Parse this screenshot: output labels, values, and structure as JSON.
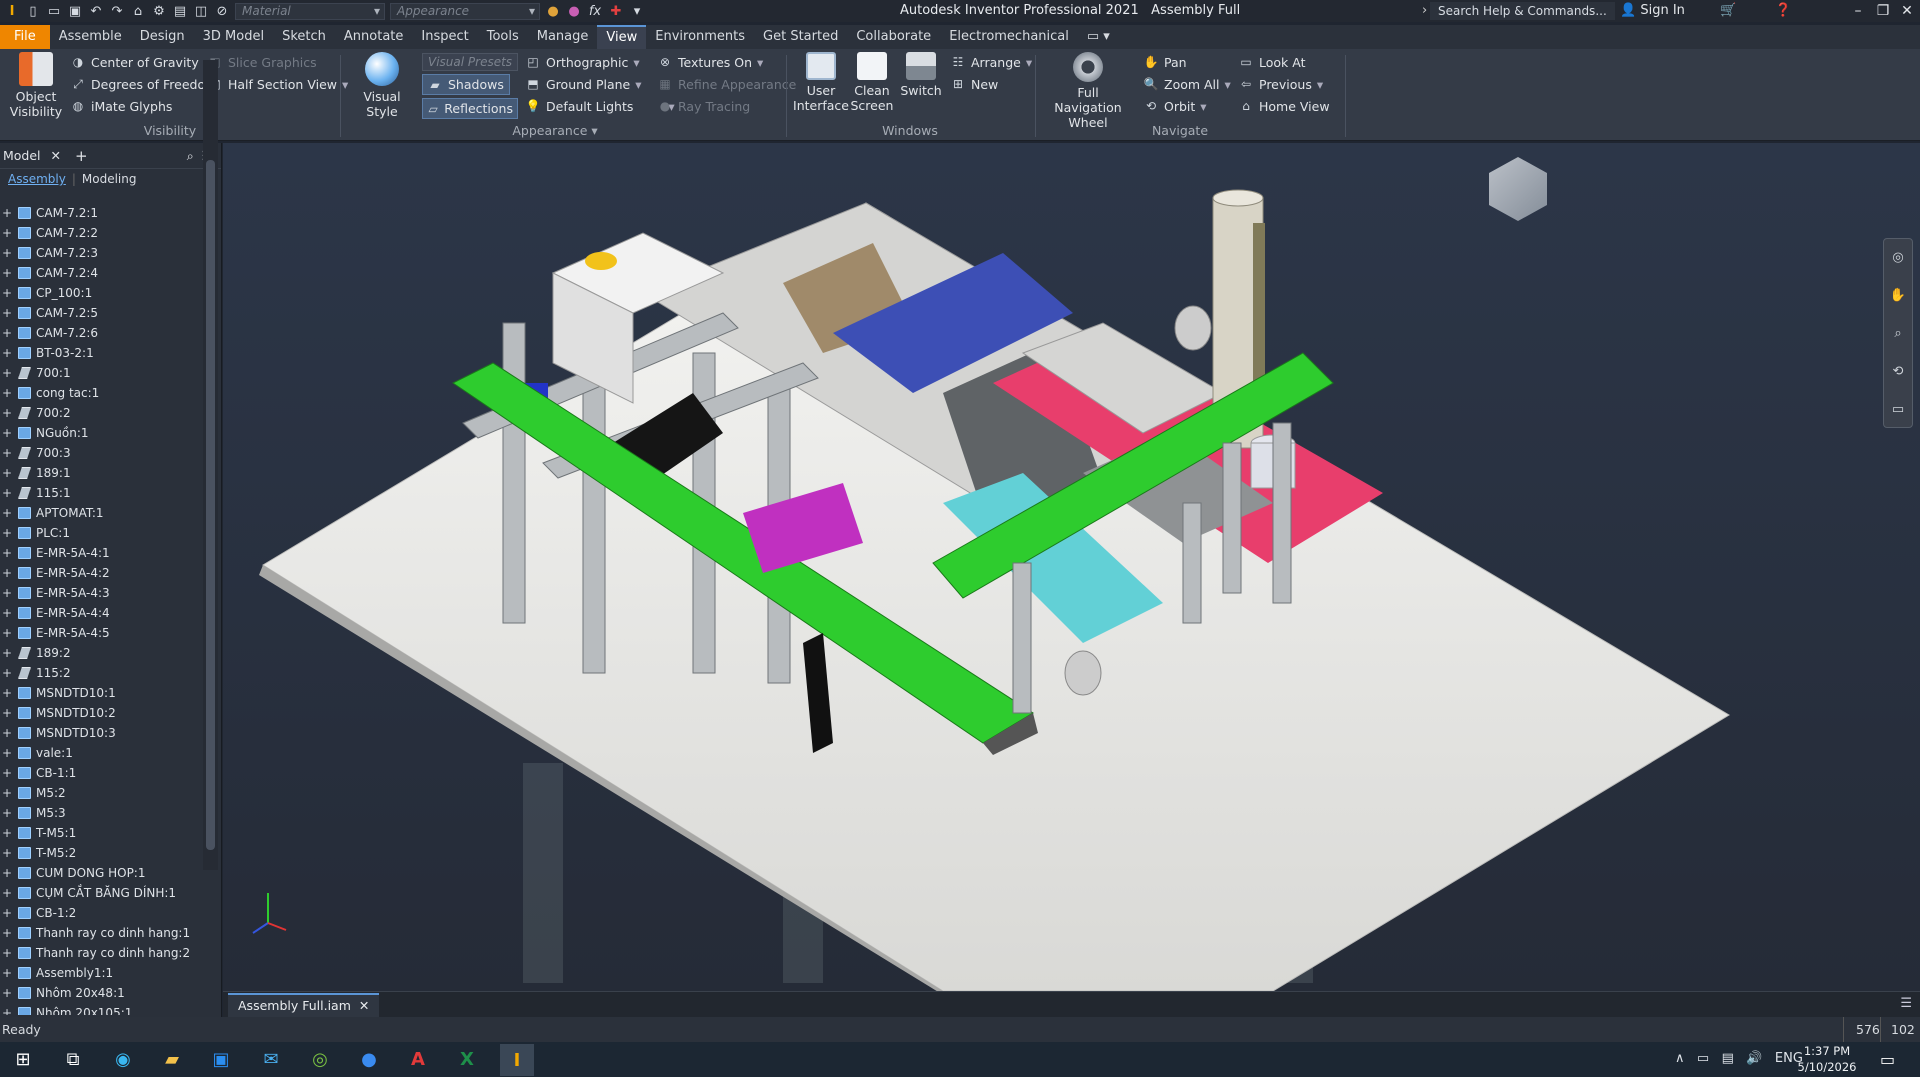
{
  "app": {
    "title": "Autodesk Inventor Professional 2021",
    "doc": "Assembly Full",
    "search_placeholder": "Search Help & Commands...",
    "sign_in": "Sign In"
  },
  "quick_access": {
    "material": "Material",
    "appearance": "Appearance"
  },
  "tabs": [
    "File",
    "Assemble",
    "Design",
    "3D Model",
    "Sketch",
    "Annotate",
    "Inspect",
    "Tools",
    "Manage",
    "View",
    "Environments",
    "Get Started",
    "Collaborate",
    "Electromechanical"
  ],
  "active_tab": "View",
  "ribbon": {
    "visibility": {
      "object_visibility": "Object Visibility",
      "center_of_gravity": "Center of Gravity",
      "degrees_of_freedom": "Degrees of Freedom",
      "imate_glyphs": "iMate Glyphs",
      "slice_graphics": "Slice Graphics",
      "half_section": "Half Section View",
      "panel": "Visibility"
    },
    "appearance": {
      "visual_style": "Visual Style",
      "visual_presets": "Visual Presets",
      "shadows": "Shadows",
      "reflections": "Reflections",
      "orthographic": "Orthographic",
      "ground_plane": "Ground Plane",
      "default_lights": "Default Lights",
      "textures_on": "Textures On",
      "refine_appearance": "Refine Appearance",
      "ray_tracing": "Ray Tracing",
      "panel": "Appearance"
    },
    "windows": {
      "user_interface": "User Interface",
      "clean_screen": "Clean Screen",
      "switch": "Switch",
      "arrange": "Arrange",
      "new": "New",
      "panel": "Windows"
    },
    "navigate": {
      "full_nav_wheel": "Full Navigation Wheel",
      "pan": "Pan",
      "zoom_all": "Zoom All",
      "orbit": "Orbit",
      "look_at": "Look At",
      "previous": "Previous",
      "home_view": "Home View",
      "panel": "Navigate"
    }
  },
  "browser": {
    "tab": "Model",
    "sub_assembly": "Assembly",
    "sub_modeling": "Modeling",
    "items": [
      {
        "label": "CAM-7.2:1",
        "type": "asm"
      },
      {
        "label": "CAM-7.2:2",
        "type": "asm"
      },
      {
        "label": "CAM-7.2:3",
        "type": "asm"
      },
      {
        "label": "CAM-7.2:4",
        "type": "asm"
      },
      {
        "label": "CP_100:1",
        "type": "asm"
      },
      {
        "label": "CAM-7.2:5",
        "type": "asm"
      },
      {
        "label": "CAM-7.2:6",
        "type": "asm"
      },
      {
        "label": "BT-03-2:1",
        "type": "asm"
      },
      {
        "label": "700:1",
        "type": "part"
      },
      {
        "label": "cong tac:1",
        "type": "asm"
      },
      {
        "label": "700:2",
        "type": "part"
      },
      {
        "label": "NGuồn:1",
        "type": "asm"
      },
      {
        "label": "700:3",
        "type": "part"
      },
      {
        "label": "189:1",
        "type": "part"
      },
      {
        "label": "115:1",
        "type": "part"
      },
      {
        "label": "APTOMAT:1",
        "type": "asm"
      },
      {
        "label": "PLC:1",
        "type": "asm"
      },
      {
        "label": "E-MR-5A-4:1",
        "type": "asm"
      },
      {
        "label": "E-MR-5A-4:2",
        "type": "asm"
      },
      {
        "label": "E-MR-5A-4:3",
        "type": "asm"
      },
      {
        "label": "E-MR-5A-4:4",
        "type": "asm"
      },
      {
        "label": "E-MR-5A-4:5",
        "type": "asm"
      },
      {
        "label": "189:2",
        "type": "part"
      },
      {
        "label": "115:2",
        "type": "part"
      },
      {
        "label": "MSNDTD10:1",
        "type": "asm"
      },
      {
        "label": "MSNDTD10:2",
        "type": "asm"
      },
      {
        "label": "MSNDTD10:3",
        "type": "asm"
      },
      {
        "label": "vale:1",
        "type": "asm"
      },
      {
        "label": "CB-1:1",
        "type": "asm"
      },
      {
        "label": "M5:2",
        "type": "asm"
      },
      {
        "label": "M5:3",
        "type": "asm"
      },
      {
        "label": "T-M5:1",
        "type": "asm"
      },
      {
        "label": "T-M5:2",
        "type": "asm"
      },
      {
        "label": "CUM DONG HOP:1",
        "type": "asm"
      },
      {
        "label": "CỤM CẮT BĂNG DÍNH:1",
        "type": "asm"
      },
      {
        "label": "CB-1:2",
        "type": "asm"
      },
      {
        "label": "Thanh ray co dinh hang:1",
        "type": "asm"
      },
      {
        "label": "Thanh ray co dinh hang:2",
        "type": "asm"
      },
      {
        "label": "Assembly1:1",
        "type": "asm"
      },
      {
        "label": "Nhôm 20x48:1",
        "type": "asm"
      },
      {
        "label": "Nhôm 20x105:1",
        "type": "asm"
      }
    ]
  },
  "document_tab": "Assembly Full.iam",
  "status": {
    "text": "Ready",
    "count_a": "576",
    "count_b": "102"
  },
  "taskbar": {
    "lang": "ENG",
    "time": "1:37 PM",
    "date": "5/10/2026"
  }
}
